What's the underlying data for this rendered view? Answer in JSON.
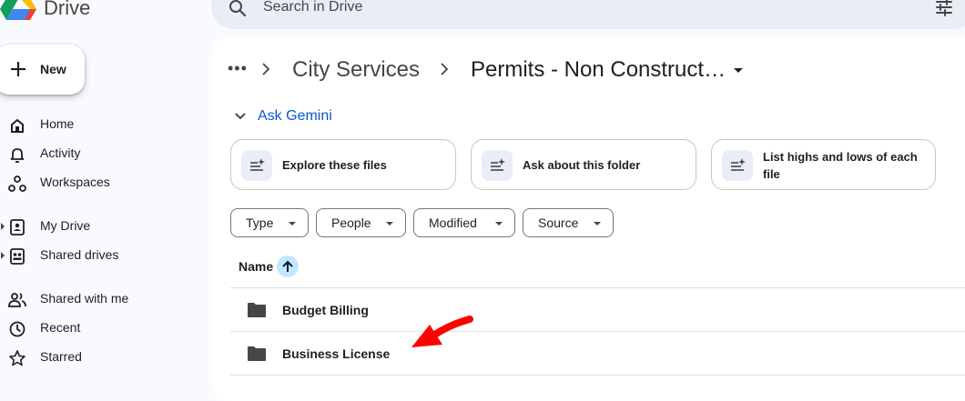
{
  "app": {
    "brand": "Drive"
  },
  "search": {
    "placeholder": "Search in Drive"
  },
  "sidebar": {
    "new_label": "New",
    "items": [
      {
        "label": "Home",
        "icon": "home-icon"
      },
      {
        "label": "Activity",
        "icon": "bell-icon"
      },
      {
        "label": "Workspaces",
        "icon": "workspaces-icon"
      },
      {
        "label": "My Drive",
        "icon": "my-drive-icon",
        "expandable": true
      },
      {
        "label": "Shared drives",
        "icon": "shared-drives-icon",
        "expandable": true
      },
      {
        "label": "Shared with me",
        "icon": "people-icon"
      },
      {
        "label": "Recent",
        "icon": "clock-icon"
      },
      {
        "label": "Starred",
        "icon": "star-icon"
      }
    ]
  },
  "breadcrumb": {
    "more": "•••",
    "items": [
      "City Services",
      "Permits - Non Construct…"
    ]
  },
  "gemini": {
    "label": "Ask Gemini",
    "chips": [
      {
        "label": "Explore these files"
      },
      {
        "label": "Ask about this folder"
      },
      {
        "label": "List highs and lows of each file"
      }
    ]
  },
  "filters": [
    "Type",
    "People",
    "Modified",
    "Source"
  ],
  "table": {
    "column_name": "Name",
    "sort": "ascending",
    "rows": [
      {
        "name": "Budget Billing",
        "type": "folder"
      },
      {
        "name": "Business License",
        "type": "folder"
      }
    ]
  },
  "colors": {
    "accent": "#0b57d0",
    "sort_bg": "#c2e7ff",
    "annotation": "#ff0000"
  }
}
